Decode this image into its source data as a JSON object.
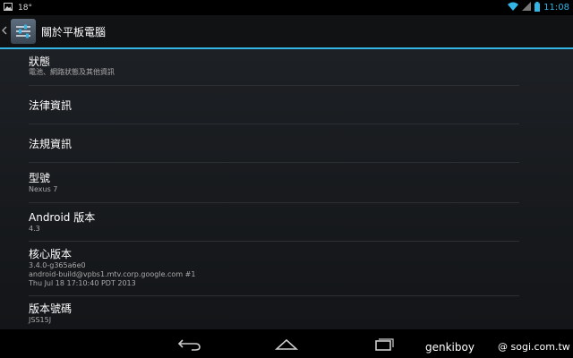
{
  "status_bar": {
    "temperature": "18°",
    "clock": "11:08"
  },
  "action_bar": {
    "title": "關於平板電腦"
  },
  "items": [
    {
      "title": "狀態",
      "lines": [
        "電池、網路狀態及其他資訊"
      ]
    },
    {
      "title": "法律資訊",
      "lines": []
    },
    {
      "title": "法規資訊",
      "lines": []
    },
    {
      "title": "型號",
      "lines": [
        "Nexus 7"
      ]
    },
    {
      "title": "Android 版本",
      "lines": [
        "4.3"
      ]
    },
    {
      "title": "核心版本",
      "lines": [
        "3.4.0-g365a6e0",
        "android-build@vpbs1.mtv.corp.google.com #1",
        "Thu Jul 18 17:10:40 PDT 2013"
      ]
    },
    {
      "title": "版本號碼",
      "lines": [
        "JSS15J"
      ]
    }
  ],
  "watermark": {
    "left": "genkiboy",
    "right": "@ sogi.com.tw"
  }
}
